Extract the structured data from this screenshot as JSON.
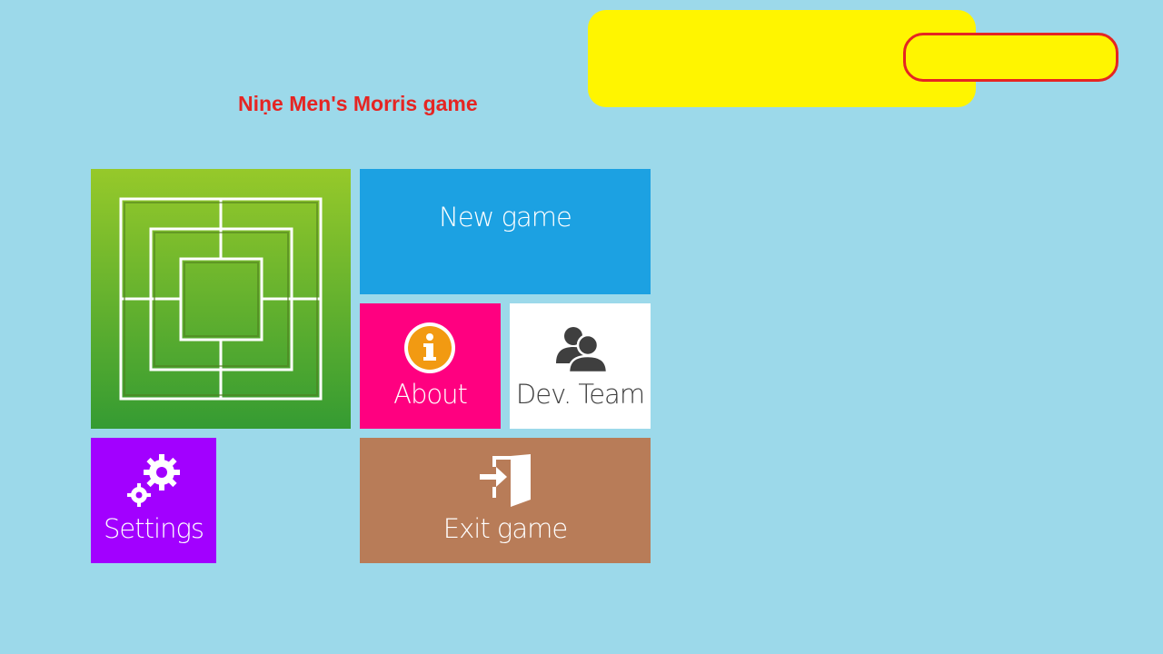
{
  "game": {
    "title": "Niṇe Men's Morris game"
  },
  "menu": {
    "new_game": "New game",
    "about": "About",
    "dev_team": "Dev. Team",
    "settings": "Settings",
    "exit_game": "Exit game"
  },
  "icons": {
    "board": "morris-board-icon",
    "about": "info-icon",
    "dev_team": "users-icon",
    "settings": "gears-icon",
    "exit": "exit-door-icon"
  },
  "colors": {
    "background": "#9cd9ea",
    "title": "#e52523",
    "panel": "#fff500",
    "board_tile_top": "#96c92a",
    "board_tile_bottom": "#359b32",
    "new_game_tile": "#1ca1e2",
    "about_tile": "#ff0080",
    "dev_team_tile": "#ffffff",
    "settings_tile": "#a200ff",
    "exit_tile": "#b87c58",
    "about_icon": "#f29a12"
  }
}
